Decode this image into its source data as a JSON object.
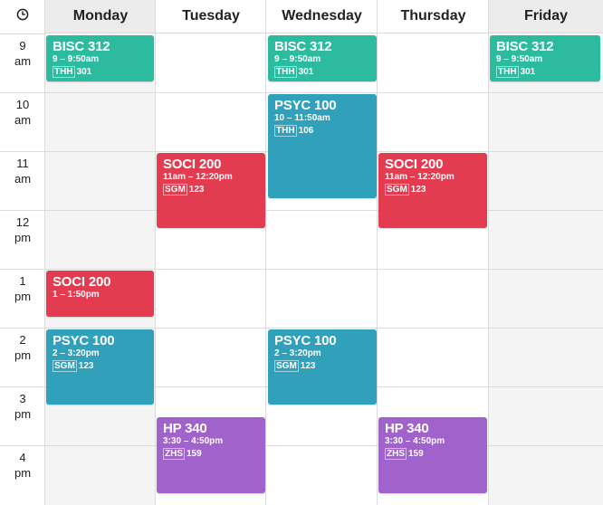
{
  "calendar": {
    "header": {
      "clock_icon": "clock-icon",
      "days": [
        "Monday",
        "Tuesday",
        "Wednesday",
        "Thursday",
        "Friday"
      ]
    },
    "times": [
      {
        "hour": "9",
        "period": "am"
      },
      {
        "hour": "10",
        "period": "am"
      },
      {
        "hour": "11",
        "period": "am"
      },
      {
        "hour": "12",
        "period": "pm"
      },
      {
        "hour": "1",
        "period": "pm"
      },
      {
        "hour": "2",
        "period": "pm"
      },
      {
        "hour": "3",
        "period": "pm"
      },
      {
        "hour": "4",
        "period": "pm"
      }
    ],
    "events": [
      {
        "day": "Monday",
        "title": "BISC 312",
        "time": "9 – 9:50am",
        "building": "THH",
        "room": "301",
        "color": "#2dbba0"
      },
      {
        "day": "Wednesday",
        "title": "BISC 312",
        "time": "9 – 9:50am",
        "building": "THH",
        "room": "301",
        "color": "#2dbba0"
      },
      {
        "day": "Friday",
        "title": "BISC 312",
        "time": "9 – 9:50am",
        "building": "THH",
        "room": "301",
        "color": "#2dbba0"
      },
      {
        "day": "Wednesday",
        "title": "PSYC 100",
        "time": "10 – 11:50am",
        "building": "THH",
        "room": "106",
        "color": "#30a0bb"
      },
      {
        "day": "Tuesday",
        "title": "SOCI 200",
        "time": "11am – 12:20pm",
        "building": "SGM",
        "room": "123",
        "color": "#e33c50"
      },
      {
        "day": "Thursday",
        "title": "SOCI 200",
        "time": "11am – 12:20pm",
        "building": "SGM",
        "room": "123",
        "color": "#e33c50"
      },
      {
        "day": "Monday",
        "title": "SOCI 200",
        "time": "1 – 1:50pm",
        "building": "",
        "room": "",
        "color": "#e33c50"
      },
      {
        "day": "Monday",
        "title": "PSYC 100",
        "time": "2 – 3:20pm",
        "building": "SGM",
        "room": "123",
        "color": "#30a0bb"
      },
      {
        "day": "Wednesday",
        "title": "PSYC 100",
        "time": "2 – 3:20pm",
        "building": "SGM",
        "room": "123",
        "color": "#30a0bb"
      },
      {
        "day": "Tuesday",
        "title": "HP 340",
        "time": "3:30 – 4:50pm",
        "building": "ZHS",
        "room": "159",
        "color": "#a063cc"
      },
      {
        "day": "Thursday",
        "title": "HP 340",
        "time": "3:30 – 4:50pm",
        "building": "ZHS",
        "room": "159",
        "color": "#a063cc"
      }
    ]
  }
}
